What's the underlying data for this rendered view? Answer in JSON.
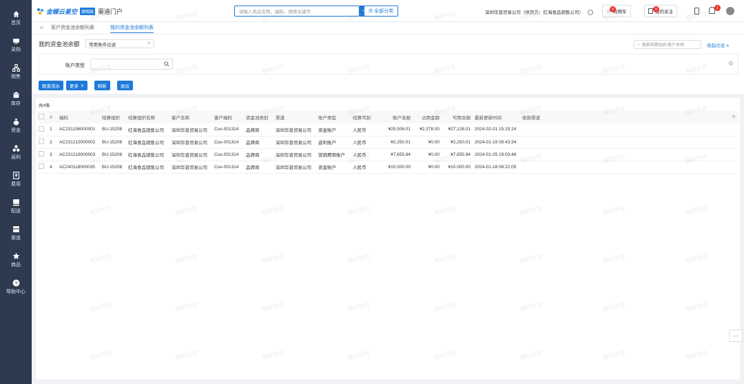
{
  "sidebar": {
    "items": [
      {
        "label": "首页",
        "icon": "home-icon"
      },
      {
        "label": "采购",
        "icon": "purchase-icon"
      },
      {
        "label": "销售",
        "icon": "sales-icon"
      },
      {
        "label": "库存",
        "icon": "inventory-icon"
      },
      {
        "label": "资金",
        "icon": "funds-icon"
      },
      {
        "label": "返利",
        "icon": "rebate-icon"
      },
      {
        "label": "费用",
        "icon": "expense-icon"
      },
      {
        "label": "配送",
        "icon": "delivery-icon"
      },
      {
        "label": "渠道",
        "icon": "channel-icon"
      },
      {
        "label": "商品",
        "icon": "product-icon"
      },
      {
        "label": "帮助中心",
        "icon": "help-icon"
      }
    ]
  },
  "header": {
    "logo": "金蝶云星空",
    "edition": "旗舰版",
    "portal": "渠道门户",
    "search_placeholder": "请输入商品名称、编码、搜索关键字",
    "category_btn": "全部分类",
    "company": "深圳华普贸易公司（供货方：红海食品销售公司）",
    "cart_label": "购物车",
    "cart_count": "0",
    "follow_label": "我的关注",
    "follow_count": "0",
    "notif_count": "1"
  },
  "tabs": [
    {
      "label": "客户资金池余额列表"
    },
    {
      "label": "我的资金池余额列表"
    }
  ],
  "panel": {
    "title": "我的资金池余额",
    "filter_select": "常用条件过滤",
    "search_placeholder": "搜索结算组织/客户名称",
    "collapse_label": "收起过滤",
    "account_type_label": "账户类型",
    "buttons": {
      "flow": "联查流水",
      "more": "更多",
      "refresh": "刷新",
      "exit": "退出"
    }
  },
  "table": {
    "count": "共4条",
    "columns": [
      "#",
      "编码",
      "结算组织",
      "结算组织名称",
      "客户名称",
      "客户编码",
      "资金池类别",
      "渠道",
      "账户类型",
      "结算币别",
      "账户余额",
      "占用金额",
      "可用余额",
      "最新更新时间",
      "收款渠道"
    ],
    "rows": [
      [
        "1",
        "AC231206000001",
        "BU-15208",
        "红海食品销售公司",
        "深圳华普贸易公司",
        "Cus-001314",
        "品牌商",
        "深圳华普贸易公司",
        "资金账户",
        "人民币",
        "¥29,506.01",
        "¥2,378.00",
        "¥27,128.01",
        "2024-02-01 15:15:24",
        ""
      ],
      [
        "2",
        "AC231215000002",
        "BU-15208",
        "红海食品销售公司",
        "深圳华普贸易公司",
        "Cus-001314",
        "品牌商",
        "深圳华普贸易公司",
        "返利账户",
        "人民币",
        "¥2,250.01",
        "¥0.00",
        "¥2,250.01",
        "2024-01-19 09:43:34",
        ""
      ],
      [
        "3",
        "AC231218000003",
        "BU-15208",
        "红海食品销售公司",
        "深圳华普贸易公司",
        "Cus-001314",
        "品牌商",
        "深圳华普贸易公司",
        "营销费用账户",
        "人民币",
        "¥7,655.94",
        "¥0.00",
        "¥7,655.94",
        "2024-01-25 19:03:48",
        ""
      ],
      [
        "4",
        "AC240118000035",
        "BU-15208",
        "红海食品销售公司",
        "深圳华普贸易公司",
        "Cus-001314",
        "品牌商",
        "深圳华普贸易公司",
        "资金账户",
        "人民币",
        "¥10,000.00",
        "¥0.00",
        "¥10,000.00",
        "2024-01-18 08:22:05",
        ""
      ]
    ]
  },
  "watermark": "临时许可",
  "colors": {
    "primary": "#1e7ad9",
    "sidebar": "#2d3a4f",
    "badge": "#e33333"
  }
}
